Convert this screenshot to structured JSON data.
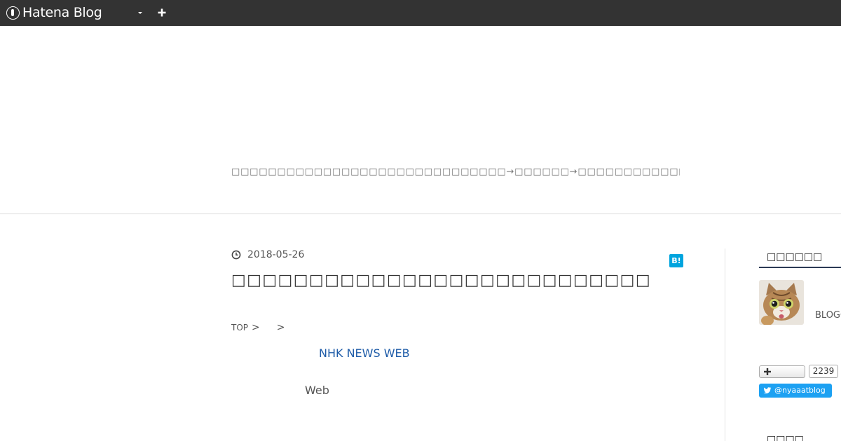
{
  "topbar": {
    "brand_name": "Hatena Blog",
    "brand_icon": "hatena-logo-icon",
    "caret_icon": "caret-down-icon",
    "plus_icon": "plus-icon"
  },
  "header": {
    "description": "□□□□□□□□□□□□□□□□□□□□□□□□□□□□□□→□□□□□□→□□□□□□□□□□□□□□□□□□□□□□□□□□□□□□□□□□□□□□□□"
  },
  "entry": {
    "date": "2018-05-26",
    "title": "□□□□□□□□□□□□□□□□□□□□□□□□□□□",
    "hatebu_label": "B!",
    "breadcrumb": {
      "top": "TOP",
      "sep": ">"
    },
    "link_text": "NHK NEWS WEB",
    "body_text": "Web"
  },
  "sidebar": {
    "profile_title": "□□□□□□",
    "profile_id": "BLOGG",
    "follow_count": "2239",
    "twitter_handle": "@nyaaatblog",
    "second_title": "□□□□"
  },
  "colors": {
    "topbar_bg": "#333333",
    "link": "#1f5ca8",
    "hatebu": "#00a4de",
    "twitter": "#1da1f2"
  }
}
